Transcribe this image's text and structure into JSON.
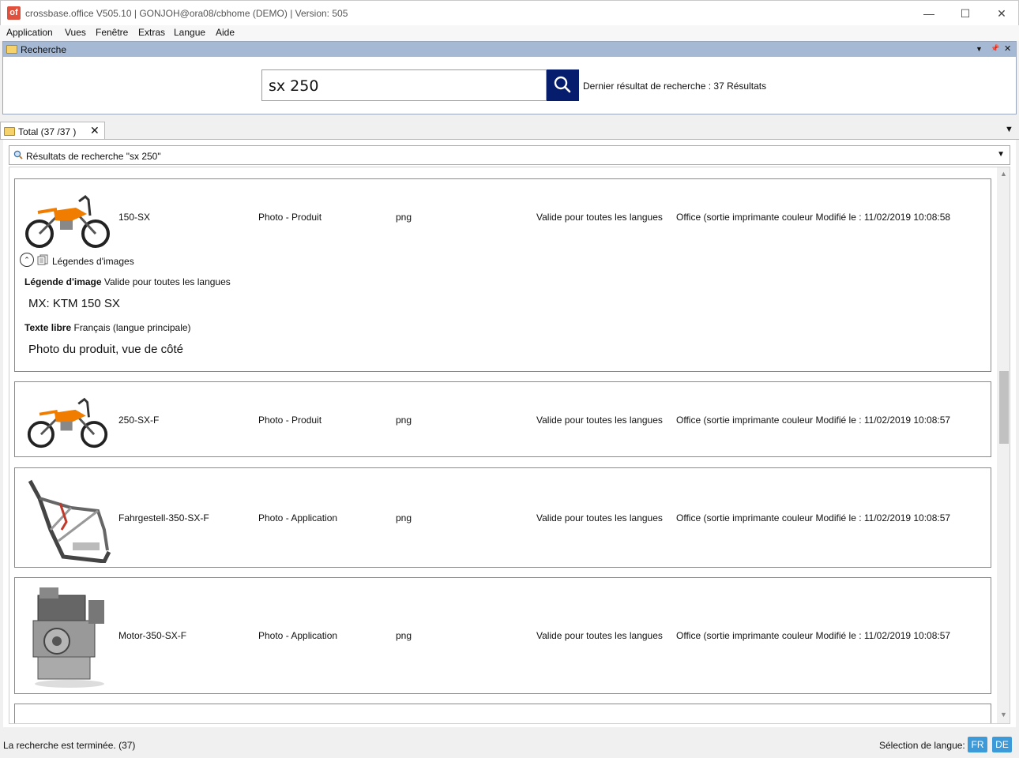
{
  "window": {
    "app_icon_text": "of",
    "title": "crossbase.office  V505.10 | GONJOH@ora08/cbhome (DEMO) | Version: 505",
    "controls": {
      "minimize": "—",
      "maximize": "☐",
      "close": "✕"
    }
  },
  "menu": {
    "items": [
      "Application",
      "Vues",
      "Fenêtre",
      "Extras",
      "Langue",
      "Aide"
    ]
  },
  "search_panel": {
    "title": "Recherche",
    "header_controls": {
      "dropdown": "▼",
      "pin": "📌",
      "close": "✕"
    },
    "query": "sx 250",
    "last_result": "Dernier résultat de recherche : 37 Résultats"
  },
  "tab": {
    "label": "Total (37 /37 )",
    "close": "✕",
    "menu": "▼"
  },
  "results": {
    "header": "Résultats de recherche \"sx 250\"",
    "items": [
      {
        "name": "150-SX",
        "type": "Photo - Produit",
        "format": "png",
        "language": "Valide pour toutes les langues",
        "office": "Office (sortie imprimante couleur Modifié le : 11/02/2019 10:08:58",
        "thumb": "motocross-bike-icon",
        "legend": {
          "toggle": "⌃",
          "title": "Légendes d'images",
          "caption_label": "Légende d'image",
          "caption_lang": "Valide pour toutes les langues",
          "caption_value": "MX: KTM 150 SX",
          "free_label": "Texte libre",
          "free_lang": "Français (langue principale)",
          "free_value": "Photo du produit, vue de côté"
        }
      },
      {
        "name": "250-SX-F",
        "type": "Photo - Produit",
        "format": "png",
        "language": "Valide pour toutes les langues",
        "office": "Office (sortie imprimante couleur Modifié le : 11/02/2019 10:08:57",
        "thumb": "motocross-bike-icon"
      },
      {
        "name": "Fahrgestell-350-SX-F",
        "type": "Photo - Application",
        "format": "png",
        "language": "Valide pour toutes les langues",
        "office": "Office (sortie imprimante couleur Modifié le : 11/02/2019 10:08:57",
        "thumb": "frame-chassis-icon"
      },
      {
        "name": "Motor-350-SX-F",
        "type": "Photo - Application",
        "format": "png",
        "language": "Valide pour toutes les langues",
        "office": "Office (sortie imprimante couleur Modifié le : 11/02/2019 10:08:57",
        "thumb": "engine-icon"
      }
    ]
  },
  "status": {
    "text": "La recherche est terminée. (37)",
    "language_label": "Sélection de langue:",
    "languages": [
      "FR",
      "DE"
    ]
  },
  "colors": {
    "panel_header": "#a6b9d4",
    "search_button": "#061d6e",
    "language_button": "#3d9ad9",
    "bike_orange": "#f07d00"
  }
}
